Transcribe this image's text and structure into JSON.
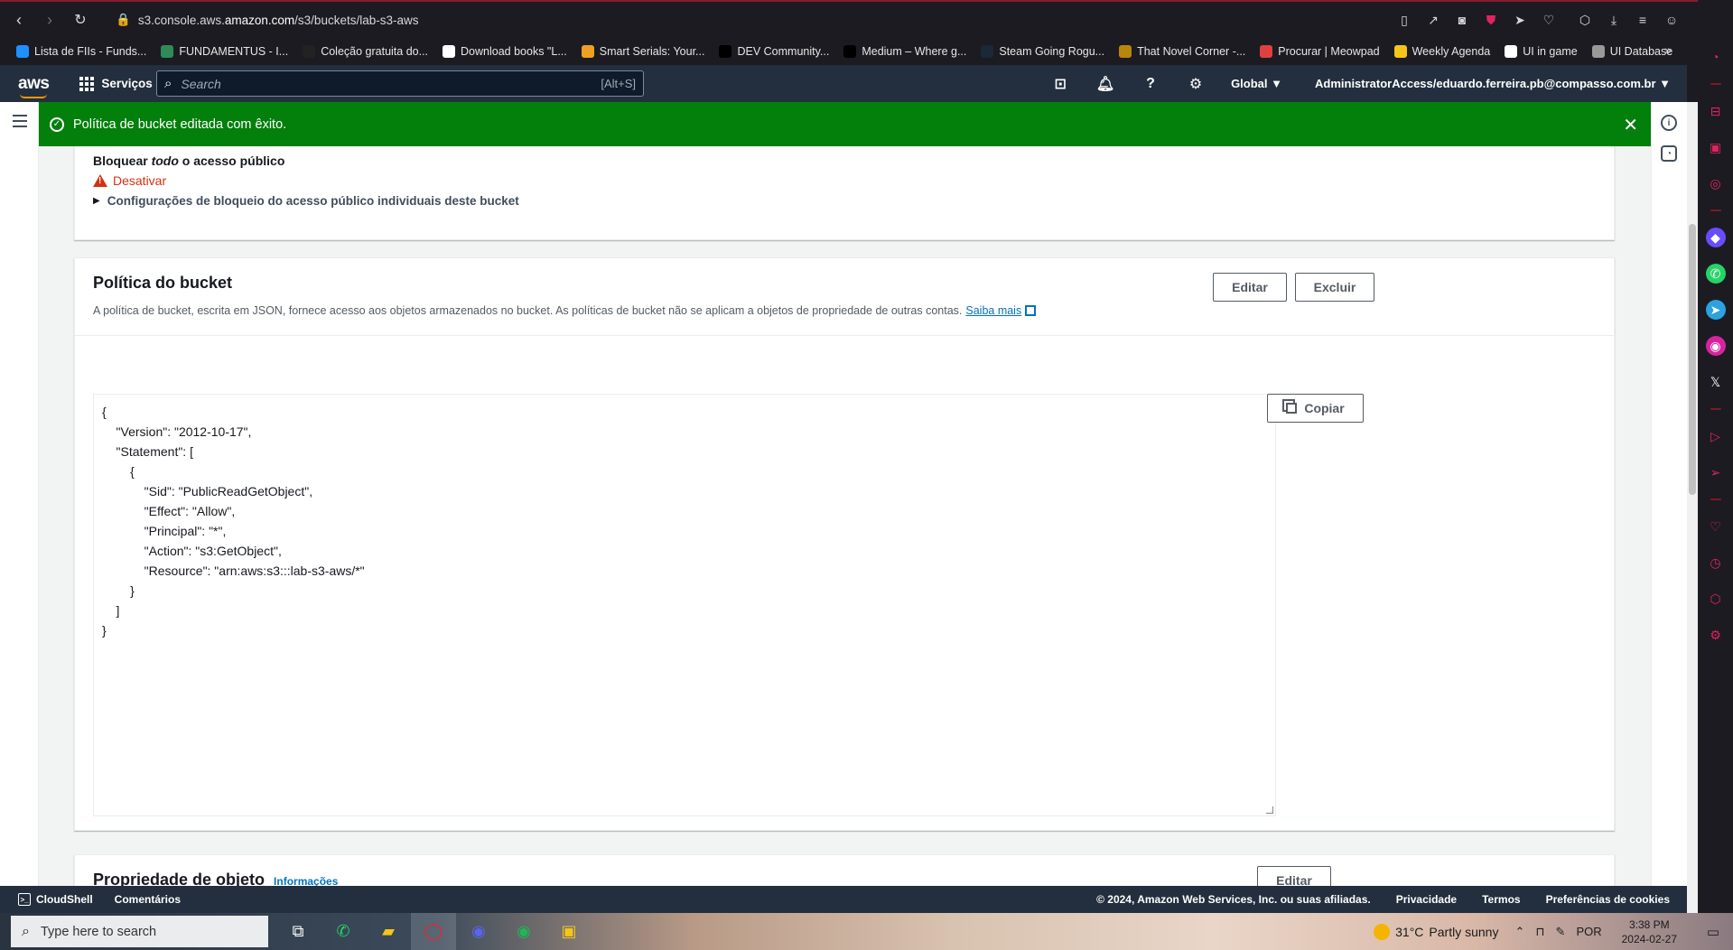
{
  "browser": {
    "url_prefix": "s3.console.aws.",
    "url_host": "amazon.com",
    "url_path": "/s3/buckets/lab-s3-aws",
    "icons": [
      "back-icon",
      "forward-icon",
      "reload-icon",
      "lock-icon",
      "reader-icon",
      "share-icon",
      "camera-icon",
      "shield-icon",
      "send-icon",
      "heart-icon",
      "box-icon",
      "download-icon",
      "menu-icon",
      "profile-icon"
    ]
  },
  "bookmarks": [
    {
      "label": "Lista de FIIs - Funds...",
      "color": "#1e90ff"
    },
    {
      "label": "FUNDAMENTUS - I...",
      "color": "#2e8b57"
    },
    {
      "label": "Coleção gratuita do...",
      "color": "#222222"
    },
    {
      "label": "Download books \"L...",
      "color": "#ffffff"
    },
    {
      "label": "Smart Serials: Your...",
      "color": "#f0a020"
    },
    {
      "label": "DEV Community...",
      "color": "#000000"
    },
    {
      "label": "Medium – Where g...",
      "color": "#000000"
    },
    {
      "label": "Steam Going Rogu...",
      "color": "#1b2838"
    },
    {
      "label": "That Novel Corner -...",
      "color": "#b8860b"
    },
    {
      "label": "Procurar | Meowpad",
      "color": "#e04040"
    },
    {
      "label": "Weekly Agenda",
      "color": "#f5c518"
    },
    {
      "label": "UI in game",
      "color": "#ffffff"
    },
    {
      "label": "UI Database",
      "color": "#999999"
    }
  ],
  "aws_nav": {
    "logo": "aws",
    "services": "Serviços",
    "search_placeholder": "Search",
    "search_shortcut": "[Alt+S]",
    "region": "Global ▼",
    "account": "AdministratorAccess/eduardo.ferreira.pb@compasso.com.br ▼"
  },
  "flash": {
    "message": "Política de bucket editada com êxito.",
    "color": "#037f0c"
  },
  "block_public_access": {
    "label_prefix": "Bloquear ",
    "label_em": "todo",
    "label_suffix": " o acesso público",
    "status": "Desativar",
    "expand_label": "Configurações de bloqueio do acesso público individuais deste bucket"
  },
  "bucket_policy": {
    "title": "Política do bucket",
    "description": "A política de bucket, escrita em JSON, fornece acesso aos objetos armazenados no bucket. As políticas de bucket não se aplicam a objetos de propriedade de outras contas.",
    "learn_more": "Saiba mais",
    "edit": "Editar",
    "delete": "Excluir",
    "copy": "Copiar",
    "policy_text": "{\n    \"Version\": \"2012-10-17\",\n    \"Statement\": [\n        {\n            \"Sid\": \"PublicReadGetObject\",\n            \"Effect\": \"Allow\",\n            \"Principal\": \"*\",\n            \"Action\": \"s3:GetObject\",\n            \"Resource\": \"arn:aws:s3:::lab-s3-aws/*\"\n        }\n    ]\n}"
  },
  "object_ownership": {
    "title": "Propriedade de objeto",
    "info": "Informações",
    "edit": "Editar"
  },
  "footer": {
    "cloudshell": "CloudShell",
    "feedback": "Comentários",
    "copyright": "© 2024, Amazon Web Services, Inc. ou suas afiliadas.",
    "privacy": "Privacidade",
    "terms": "Termos",
    "cookies": "Preferências de cookies"
  },
  "taskbar": {
    "search_placeholder": "Type here to search",
    "temperature": "31°C",
    "weather": "Partly sunny",
    "language": "POR",
    "time": "3:38 PM",
    "date": "2024-02-27"
  }
}
